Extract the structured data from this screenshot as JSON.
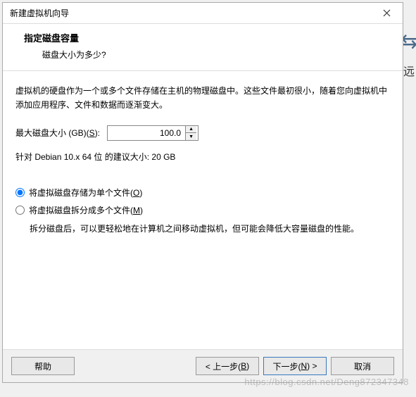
{
  "titlebar": {
    "title": "新建虚拟机向导"
  },
  "header": {
    "title": "指定磁盘容量",
    "subtitle": "磁盘大小为多少?"
  },
  "content": {
    "description": "虚拟机的硬盘作为一个或多个文件存储在主机的物理磁盘中。这些文件最初很小，随着您向虚拟机中添加应用程序、文件和数据而逐渐变大。",
    "size_label_prefix": "最大磁盘大小 (GB)(",
    "size_label_key": "S",
    "size_label_suffix": "):",
    "size_value": "100.0",
    "recommend": "针对 Debian 10.x 64 位 的建议大小: 20 GB",
    "radio_single_prefix": "将虚拟磁盘存储为单个文件(",
    "radio_single_key": "O",
    "radio_single_suffix": ")",
    "radio_split_prefix": "将虚拟磁盘拆分成多个文件(",
    "radio_split_key": "M",
    "radio_split_suffix": ")",
    "split_note": "拆分磁盘后，可以更轻松地在计算机之间移动虚拟机，但可能会降低大容量磁盘的性能。"
  },
  "footer": {
    "help": "帮助",
    "back_prefix": "< 上一步(",
    "back_key": "B",
    "back_suffix": ")",
    "next_prefix": "下一步(",
    "next_key": "N",
    "next_suffix": ") >",
    "cancel": "取消"
  },
  "bg": {
    "text": "远"
  },
  "watermark": "https://blog.csdn.net/Deng872347348"
}
